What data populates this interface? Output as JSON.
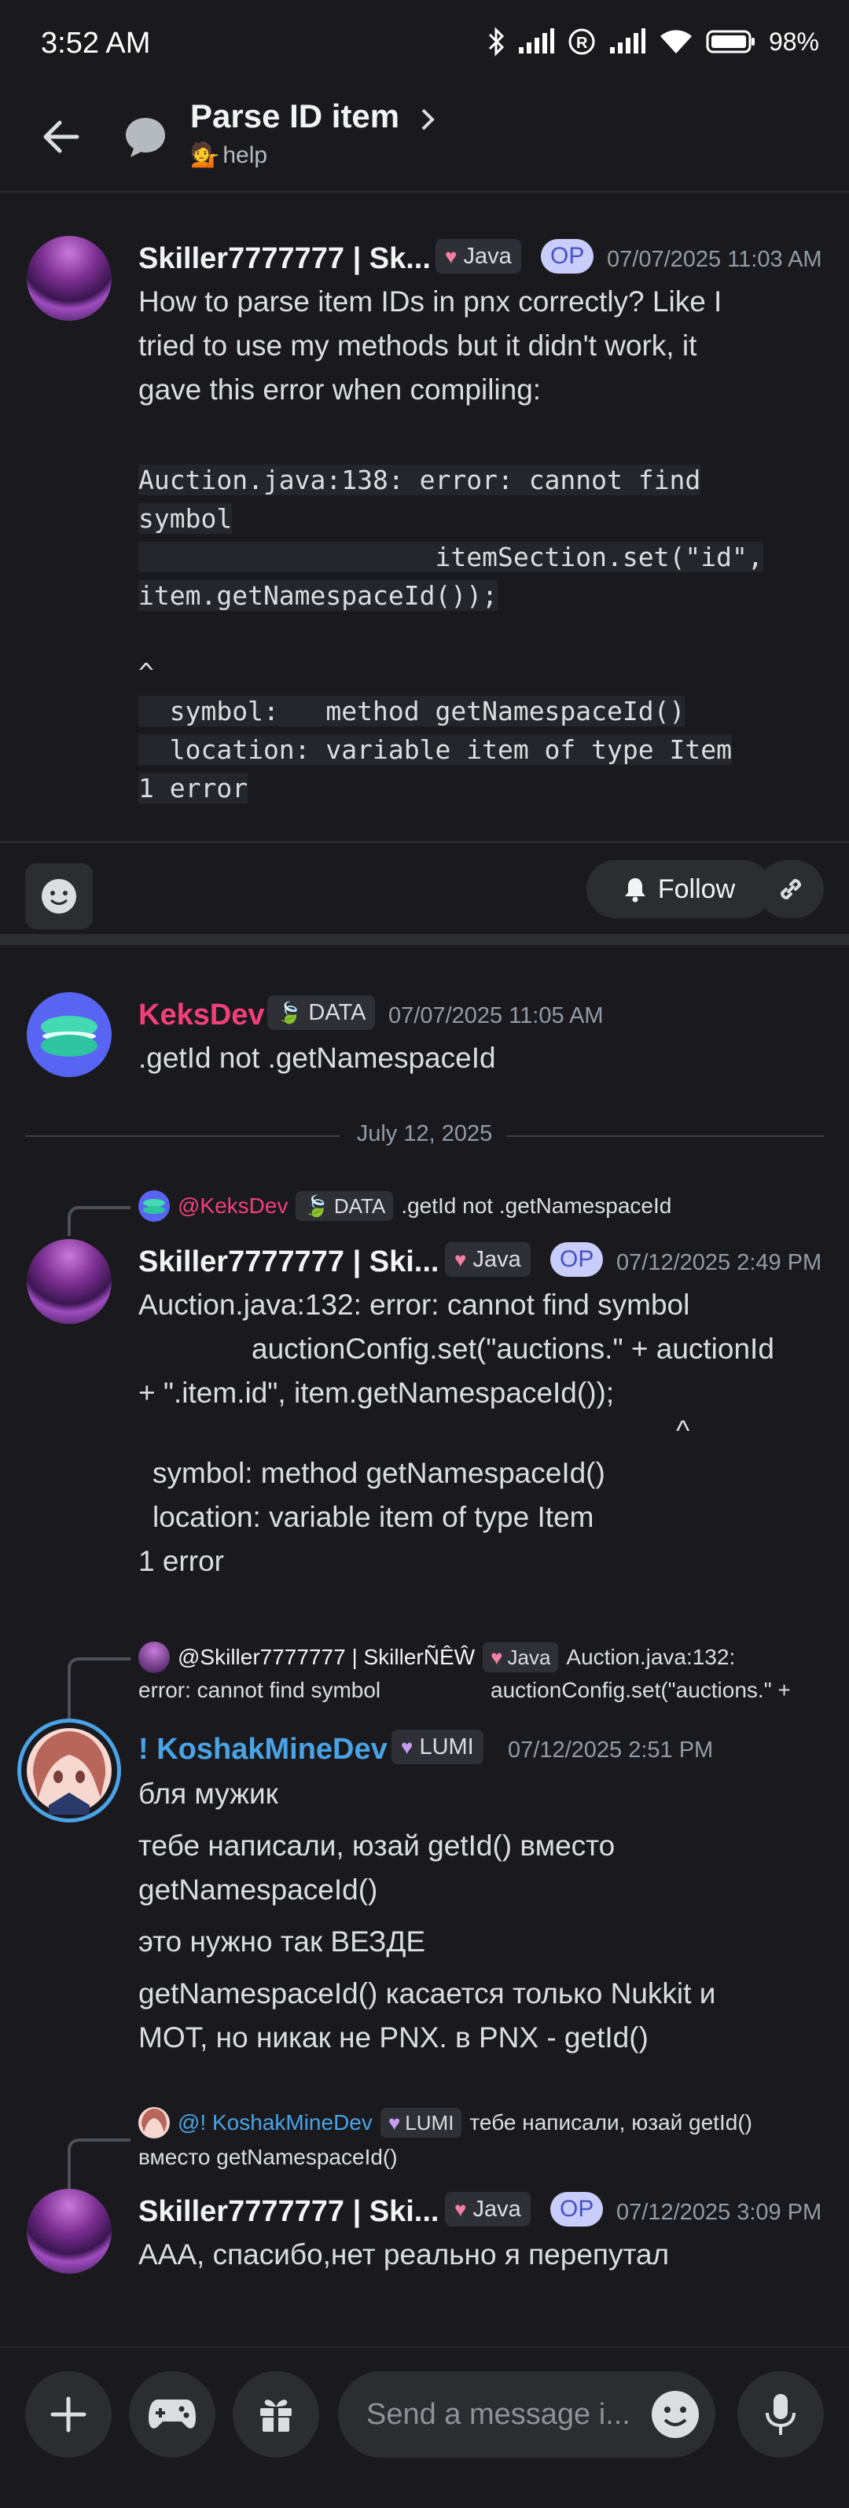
{
  "status_bar": {
    "time": "3:52 AM",
    "battery": "98"
  },
  "header": {
    "title": "Parse ID item",
    "channel_emoji": "💁",
    "channel": "help"
  },
  "op_post": {
    "author": "Skiller7777777 | Sk...",
    "tag": "Java",
    "op": "OP",
    "timestamp": "07/07/2025 11:03 AM",
    "text": [
      "How to parse item IDs in pnx correctly? Like I",
      "tried to use my methods but it didn't work, it",
      "gave this error when compiling:"
    ],
    "code": [
      "Auction.java:138: error: cannot find",
      "symbol",
      "                   itemSection.set(\"id\",",
      "item.getNamespaceId());",
      "",
      "^",
      "  symbol:   method getNamespaceId()",
      "  location: variable item of type Item",
      "1 error"
    ]
  },
  "actions": {
    "follow": "Follow"
  },
  "messages": {
    "m1": {
      "author": "KeksDev",
      "tag": "DATA",
      "timestamp": "07/07/2025 11:05 AM",
      "text": ".getId not .getNamespaceId"
    },
    "date_divider": "July 12, 2025",
    "m2": {
      "reply": {
        "author": "@KeksDev",
        "tag": "DATA",
        "text": ".getId not .getNamespaceId"
      },
      "author": "Skiller7777777 | Ski...",
      "tag": "Java",
      "op": "OP",
      "timestamp": "07/12/2025 2:49 PM",
      "lines": [
        "Auction.java:132: error: cannot find symbol",
        "auctionConfig.set(\"auctions.\" + auctionId",
        "+ \".item.id\", item.getNamespaceId());",
        "^",
        "symbol:   method getNamespaceId()",
        "location: variable item of type Item",
        "1 error"
      ]
    },
    "m3": {
      "reply": {
        "author": "@Skiller7777777 | SkillerÑÊŴ",
        "tag": "Java",
        "text1": "Auction.java:132:",
        "text2a": "error: cannot find symbol",
        "text2b": "auctionConfig.set(\"auctions.\" +"
      },
      "author": "! KoshakMineDev",
      "tag": "LUMI",
      "timestamp": "07/12/2025 2:51 PM",
      "lines": [
        "бля мужик",
        "тебе написали, юзай getId() вместо",
        "getNamespaceId()",
        "это нужно так ВЕЗДЕ",
        "getNamespaceId() касается только Nukkit и",
        "MOT, но никак не PNX. в PNX - getId()"
      ]
    },
    "m4": {
      "reply": {
        "author": "@! KoshakMineDev",
        "tag": "LUMI",
        "text1": "тебе написали, юзай getId()",
        "text2": "вместо getNamespaceId()"
      },
      "author": "Skiller7777777 | Ski...",
      "tag": "Java",
      "op": "OP",
      "timestamp": "07/12/2025 3:09 PM",
      "text": "ААА, спасибо,нет реально я перепутал"
    }
  },
  "composer": {
    "placeholder": "Send a message i..."
  },
  "colors": {
    "keks": "#f23f79",
    "koshak": "#4aa3e6",
    "op_bg": "#c9cdfb",
    "bg": "#1a1a1e"
  }
}
